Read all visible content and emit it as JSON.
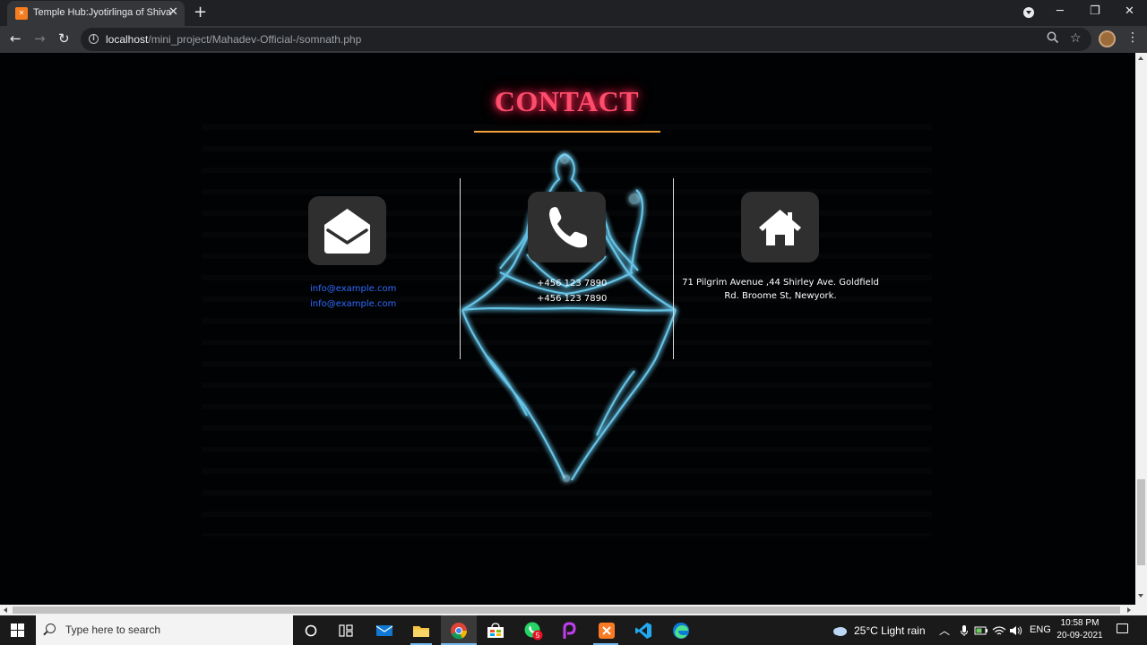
{
  "browser": {
    "tab_title": "Temple Hub:Jyotirlinga of Shiva",
    "url_host": "localhost",
    "url_path": "/mini_project/Mahadev-Official-/somnath.php"
  },
  "contact": {
    "title": "CONTACT",
    "emails": [
      "info@example.com",
      "info@example.com"
    ],
    "phones": [
      "+456 123 7890",
      "+456 123 7890"
    ],
    "address_line1": "71 Pilgrim Avenue ,44 Shirley Ave. Goldfield",
    "address_line2": "Rd. Broome St, Newyork.",
    "colors": {
      "title": "#ff4d6d",
      "underline": "#f2a23a",
      "link": "#2f6bff",
      "tile": "#2f2f2f"
    },
    "icons": [
      "envelope-open-icon",
      "phone-icon",
      "home-icon"
    ]
  },
  "taskbar": {
    "search_placeholder": "Type here to search",
    "weather": "25°C  Light rain",
    "language": "ENG",
    "time": "10:58 PM",
    "date": "20-09-2021",
    "whatsapp_badge": "5"
  }
}
